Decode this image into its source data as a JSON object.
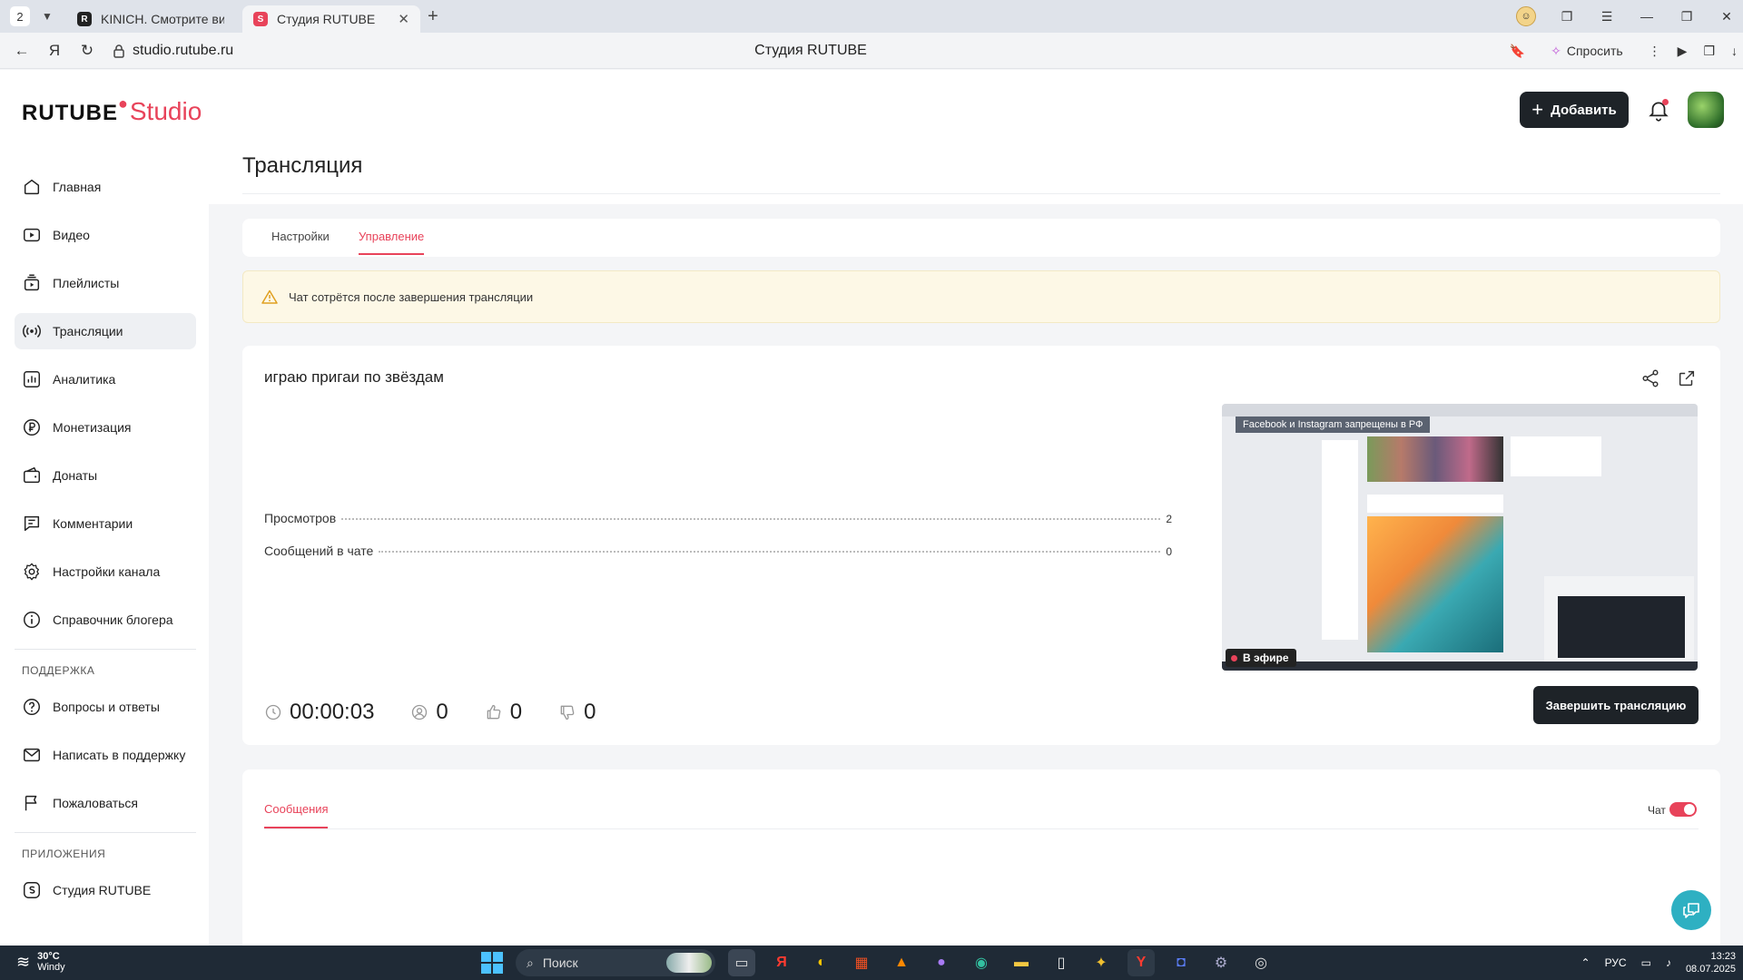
{
  "browser": {
    "tab_count": "2",
    "tabs": [
      {
        "title": "KINICH. Смотрите видео"
      },
      {
        "title": "Студия RUTUBE"
      }
    ],
    "url": "studio.rutube.ru",
    "page_title": "Студия RUTUBE",
    "ask_label": "Спросить"
  },
  "header": {
    "logo_main": "RUTUBE",
    "logo_sub": "Studio",
    "add_label": "Добавить"
  },
  "sidebar": {
    "items": [
      {
        "label": "Главная"
      },
      {
        "label": "Видео"
      },
      {
        "label": "Плейлисты"
      },
      {
        "label": "Трансляции"
      },
      {
        "label": "Аналитика"
      },
      {
        "label": "Монетизация"
      },
      {
        "label": "Донаты"
      },
      {
        "label": "Комментарии"
      },
      {
        "label": "Настройки канала"
      },
      {
        "label": "Справочник блогера"
      }
    ],
    "support_heading": "ПОДДЕРЖКА",
    "support_items": [
      {
        "label": "Вопросы и ответы"
      },
      {
        "label": "Написать в поддержку"
      },
      {
        "label": "Пожаловаться"
      }
    ],
    "apps_heading": "ПРИЛОЖЕНИЯ",
    "apps_items": [
      {
        "label": "Студия RUTUBE"
      }
    ]
  },
  "main": {
    "page_heading": "Трансляция",
    "tabs": [
      {
        "label": "Настройки"
      },
      {
        "label": "Управление"
      }
    ],
    "warning_text": "Чат сотрётся после завершения трансляции",
    "stream": {
      "title": "играю пригаи по звёздам",
      "stats": [
        {
          "label": "Просмотров",
          "value": "2"
        },
        {
          "label": "Сообщений в чате",
          "value": "0"
        }
      ],
      "preview_banner": "Facebook и Instagram запрещены в РФ",
      "live_label": "В эфире",
      "duration": "00:00:03",
      "viewers": "0",
      "likes": "0",
      "dislikes": "0",
      "end_label": "Завершить трансляцию"
    },
    "chat": {
      "tab_label": "Сообщения",
      "toggle_label": "Чат",
      "enabled": true
    }
  },
  "taskbar": {
    "temperature": "30°C",
    "weather": "Windy",
    "search_label": "Поиск",
    "lang": "РУС",
    "time": "13:23",
    "date": "08.07.2025"
  },
  "colors": {
    "accent": "#e8435a",
    "dark_button": "#1e2328",
    "warning_bg": "#fdf8e6",
    "help_fab": "#2eb0c2"
  }
}
